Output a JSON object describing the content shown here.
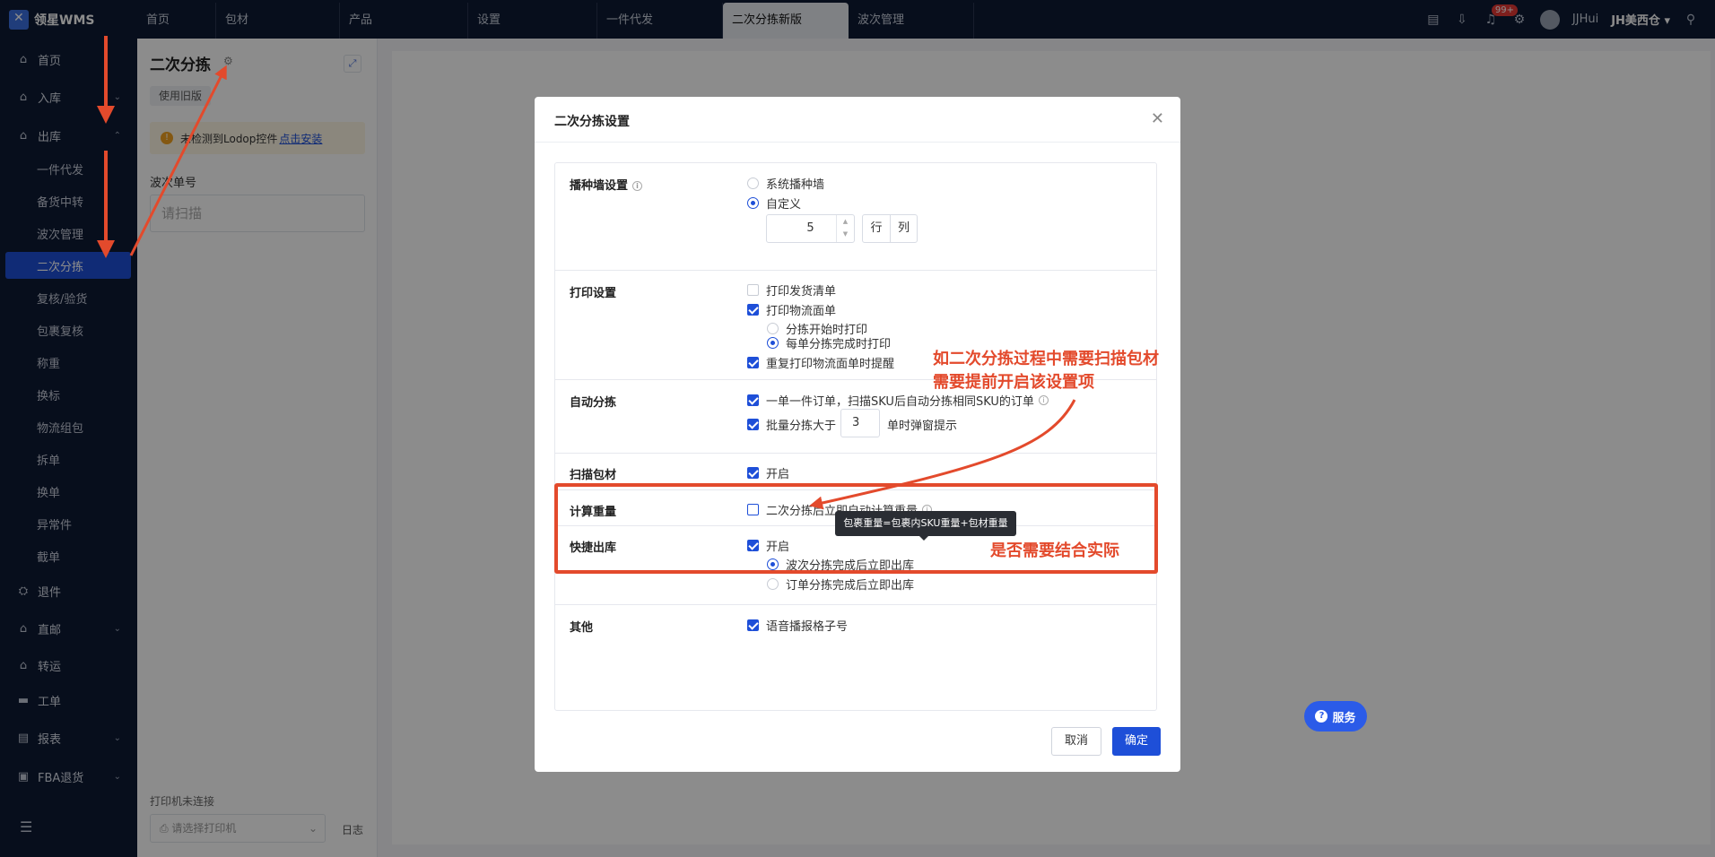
{
  "app": {
    "logo_text": "领星WMS"
  },
  "top_tabs": [
    "首页",
    "包材",
    "产品",
    "设置",
    "一件代发",
    "二次分拣新版",
    "波次管理"
  ],
  "top_right": {
    "badge": "99+",
    "user": "JJHui",
    "warehouse": "JH美西仓"
  },
  "sidebar": {
    "items": [
      {
        "label": "首页",
        "icon": "home-icon",
        "glyph": "⌂"
      },
      {
        "label": "入库",
        "icon": "inbound-icon",
        "glyph": "⌂",
        "chevron": "⌄"
      },
      {
        "label": "出库",
        "icon": "outbound-icon",
        "glyph": "⌂",
        "chevron": "⌃"
      }
    ],
    "sub_items": [
      "一件代发",
      "备货中转",
      "波次管理",
      "二次分拣",
      "复核/验货",
      "包裹复核",
      "称重",
      "换标",
      "物流组包",
      "拆单",
      "换单",
      "异常件",
      "截单"
    ],
    "more_items": [
      {
        "label": "退件",
        "icon": "return-icon",
        "glyph": "⛭"
      },
      {
        "label": "直邮",
        "icon": "direct-mail-icon",
        "glyph": "⌂",
        "chevron": "⌄"
      },
      {
        "label": "转运",
        "icon": "transfer-icon",
        "glyph": "⌂"
      },
      {
        "label": "工单",
        "icon": "ticket-icon",
        "glyph": "▬"
      },
      {
        "label": "报表",
        "icon": "report-icon",
        "glyph": "▤",
        "chevron": "⌄"
      },
      {
        "label": "FBA退货",
        "icon": "fba-return-icon",
        "glyph": "▣",
        "chevron": "⌄"
      }
    ]
  },
  "panel": {
    "title": "二次分拣",
    "old_version_btn": "使用旧版",
    "warning_text": "未检测到Lodop控件",
    "warning_link": "点击安装",
    "wave_label": "波次单号",
    "wave_placeholder": "请扫描",
    "printer_status": "打印机未连接",
    "printer_placeholder": "请选择打印机",
    "log_label": "日志"
  },
  "modal": {
    "title": "二次分拣设置",
    "sections": {
      "seeding_wall": {
        "label": "播种墙设置",
        "opt_system": "系统播种墙",
        "opt_custom": "自定义",
        "count": "5",
        "seg_row": "行",
        "seg_col": "列"
      },
      "print": {
        "label": "打印设置",
        "opt_packing": "打印发货清单",
        "opt_waybill": "打印物流面单",
        "sub_start": "分拣开始时打印",
        "sub_each": "每单分拣完成时打印",
        "opt_reprint": "重复打印物流面单时提醒"
      },
      "auto_sort": {
        "label": "自动分拣",
        "opt_single": "一单一件订单，扫描SKU后自动分拣相同SKU的订单",
        "opt_batch_prefix": "批量分拣大于",
        "batch_value": "3",
        "opt_batch_suffix": "单时弹窗提示"
      },
      "scan_pack": {
        "label": "扫描包材",
        "opt_enable": "开启"
      },
      "weight": {
        "label": "计算重量",
        "opt_auto": "二次分拣后立即自动计算重量"
      },
      "quick_out": {
        "label": "快捷出库",
        "opt_enable": "开启",
        "sub_wave": "波次分拣完成后立即出库",
        "sub_order": "订单分拣完成后立即出库"
      },
      "other": {
        "label": "其他",
        "opt_voice": "语音播报格子号"
      }
    },
    "cancel_btn": "取消",
    "ok_btn": "确定"
  },
  "tooltip": "包裹重量=包裹内SKU重量+包材重量",
  "annotations": {
    "note1_line1": "如二次分拣过程中需要扫描包材",
    "note1_line2": "需要提前开启该设置项",
    "note2": "是否需要结合实际"
  },
  "service_btn": "服务",
  "colors": {
    "primary": "#1e4fd8",
    "nav_bg": "#0e1a33",
    "annotation": "#e34a2c"
  }
}
